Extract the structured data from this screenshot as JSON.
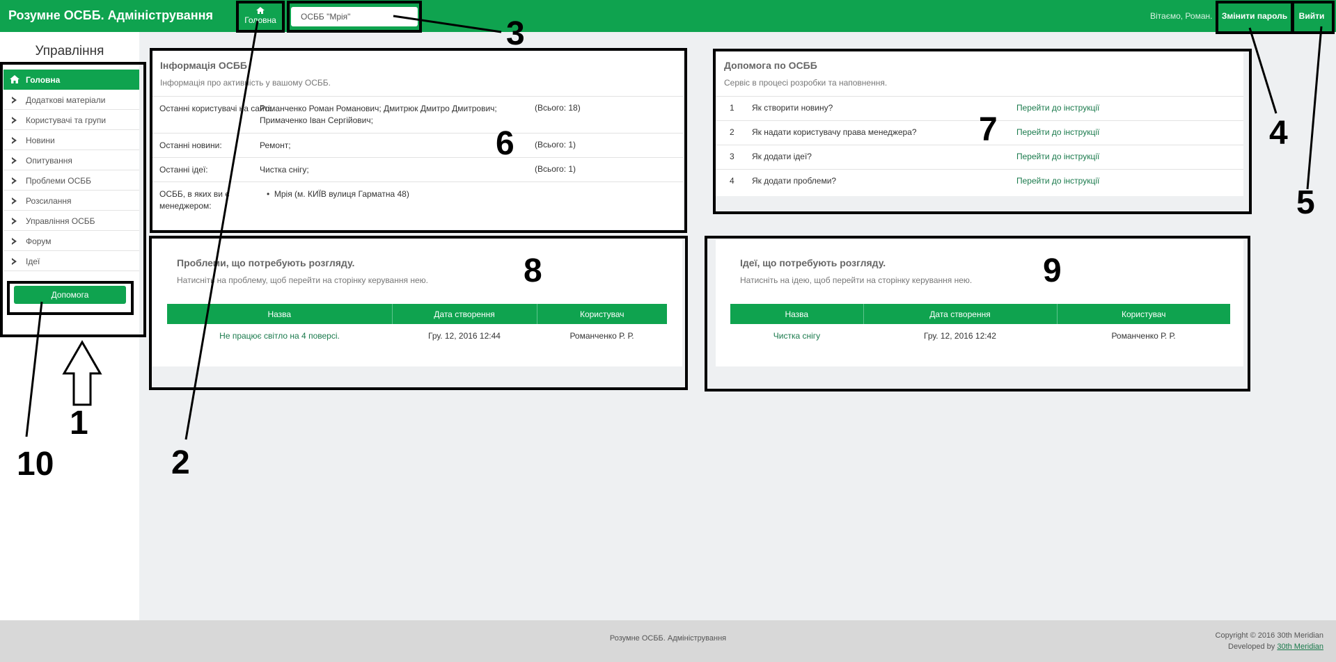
{
  "app": {
    "title": "Розумне ОСББ. Адміністрування"
  },
  "topbar": {
    "home_label": "Головна",
    "osbb_selected": "ОСББ \"Мрія\"",
    "welcome": "Вітаємо, Роман.",
    "change_password": "Змінити пароль",
    "logout": "Вийти"
  },
  "sidebar": {
    "title": "Управління",
    "items": [
      {
        "label": "Головна",
        "icon": "home-icon",
        "active": true
      },
      {
        "label": "Додаткові матеріали",
        "icon": "chevron-right-icon"
      },
      {
        "label": "Користувачі та групи",
        "icon": "chevron-right-icon"
      },
      {
        "label": "Новини",
        "icon": "chevron-right-icon"
      },
      {
        "label": "Опитування",
        "icon": "chevron-right-icon"
      },
      {
        "label": "Проблеми ОСББ",
        "icon": "chevron-right-icon"
      },
      {
        "label": "Розсилання",
        "icon": "chevron-right-icon"
      },
      {
        "label": "Управління ОСББ",
        "icon": "chevron-right-icon"
      },
      {
        "label": "Форум",
        "icon": "chevron-right-icon"
      },
      {
        "label": "Ідеї",
        "icon": "chevron-right-icon"
      }
    ],
    "help_button": "Допомога"
  },
  "info_panel": {
    "title": "Інформація ОСББ",
    "subtitle": "Інформація про активність у вашому ОСББ.",
    "rows": [
      {
        "label": "Останні користувачі на сайті:",
        "value": "Романченко Роман Романович; Дмитрюк Дмитро Дмитрович; Примаченко Іван Сергійович;",
        "count": "(Всього: 18)"
      },
      {
        "label": "Останні новини:",
        "value": "Ремонт;",
        "count": "(Всього: 1)"
      },
      {
        "label": "Останні ідеї:",
        "value": "Чистка снігу;",
        "count": "(Всього: 1)"
      },
      {
        "label": "ОСББ, в яких ви є менеджером:",
        "value": "Мрія (м. КИЇВ вулиця Гарматна 48)",
        "count": ""
      }
    ]
  },
  "help_panel": {
    "title": "Допомога по ОСББ",
    "subtitle": "Сервіс в процесі розробки та наповнення.",
    "rows": [
      {
        "num": "1",
        "question": "Як створити новину?",
        "link": "Перейти до інструкції"
      },
      {
        "num": "2",
        "question": "Як надати користувачу права менеджера?",
        "link": "Перейти до інструкції"
      },
      {
        "num": "3",
        "question": "Як додати ідеї?",
        "link": "Перейти до інструкції"
      },
      {
        "num": "4",
        "question": "Як додати проблеми?",
        "link": "Перейти до інструкції"
      }
    ]
  },
  "problems_panel": {
    "title": "Проблеми, що потребують розгляду.",
    "subtitle": "Натисніть на проблему, щоб перейти на сторінку керування нею.",
    "columns": [
      "Назва",
      "Дата створення",
      "Користувач"
    ],
    "rows": [
      [
        "Не працює світло на 4 поверсі.",
        "Гру. 12, 2016 12:44",
        "Романченко Р. Р."
      ]
    ]
  },
  "ideas_panel": {
    "title": "Ідеї, що потребують розгляду.",
    "subtitle": "Натисніть на ідею, щоб перейти на сторінку керування нею.",
    "columns": [
      "Назва",
      "Дата створення",
      "Користувач"
    ],
    "rows": [
      [
        "Чистка снігу",
        "Гру. 12, 2016 12:42",
        "Романченко Р. Р."
      ]
    ]
  },
  "annotations": [
    "1",
    "2",
    "3",
    "4",
    "5",
    "6",
    "7",
    "8",
    "9",
    "10"
  ],
  "footer": {
    "center": "Розумне ОСББ. Адміністрування",
    "copyright": "Copyright © 2016 30th Meridian",
    "developed_by_prefix": "Developed by",
    "developed_by_link": "30th Meridian"
  },
  "colors": {
    "brand_green": "#0fa34f",
    "link_green": "#1a7a4c",
    "annotation_black": "#000000"
  }
}
